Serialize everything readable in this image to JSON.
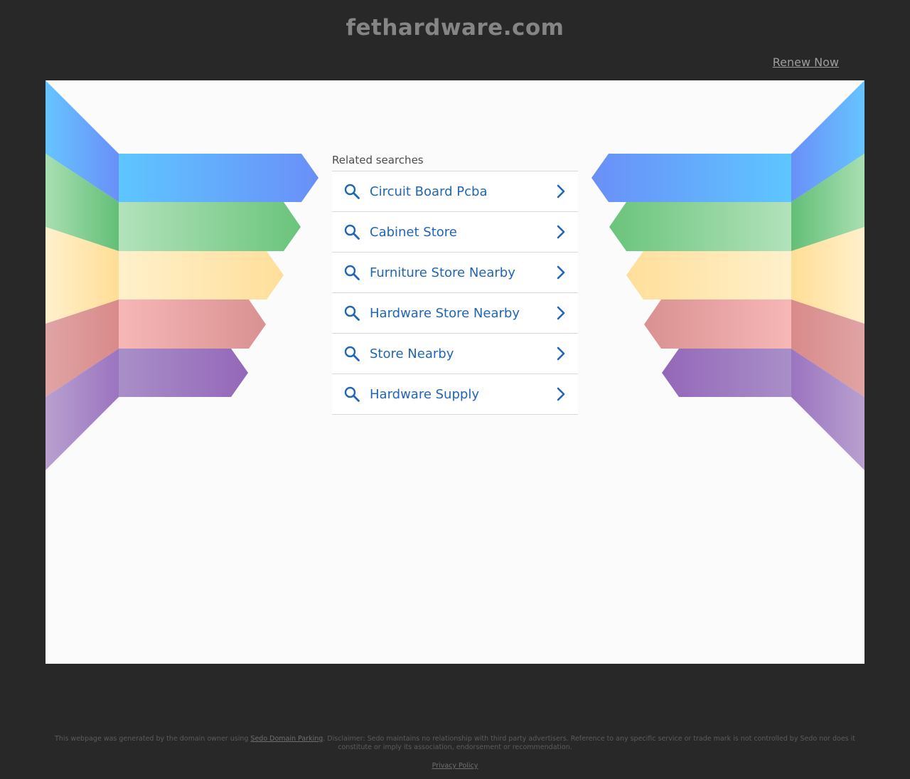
{
  "header": {
    "domain": "fethardware.com",
    "renew_label": "Renew Now"
  },
  "related": {
    "title": "Related searches",
    "items": [
      {
        "label": "Circuit Board Pcba"
      },
      {
        "label": "Cabinet Store"
      },
      {
        "label": "Furniture Store Nearby"
      },
      {
        "label": "Hardware Store Nearby"
      },
      {
        "label": "Store Nearby"
      },
      {
        "label": "Hardware Supply"
      }
    ]
  },
  "footer": {
    "text_before": "This webpage was generated by the domain owner using ",
    "sedo_link": "Sedo Domain Parking",
    "text_after": ". Disclaimer: Sedo maintains no relationship with third party advertisers. Reference to any specific service or trade mark is not controlled by Sedo nor does it constitute or imply its association, endorsement or recommendation.",
    "privacy_label": "Privacy Policy"
  },
  "colors": {
    "background": "#282828",
    "panel": "#fbfbfb",
    "link_blue": "#1f66b5",
    "band_blue": "#62a8ff",
    "band_green": "#7dcc8c",
    "band_yellow": "#ffe3a3",
    "band_pink": "#eba3a3",
    "band_purple": "#a889c4"
  },
  "icons": {
    "search": "search-icon",
    "chevron": "chevron-right-icon"
  }
}
